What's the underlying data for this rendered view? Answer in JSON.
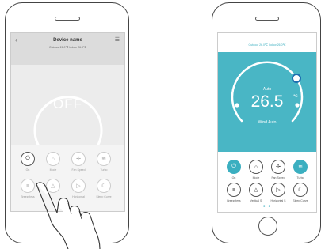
{
  "left_screen": {
    "back_icon": "chevron-left-icon",
    "title": "Device name",
    "subtitle": "Outdoor 26.0℃ Indoor 26.0℃",
    "power_state": "OFF",
    "buttons": [
      {
        "label": "On",
        "icon": "power-icon"
      },
      {
        "label": "Mode",
        "icon": "home-icon"
      },
      {
        "label": "Fan Speed",
        "icon": "fan-icon"
      },
      {
        "label": "Turbo",
        "icon": "turbo-icon"
      },
      {
        "label": "Breezeless",
        "icon": "breeze-icon"
      },
      {
        "label": "",
        "icon": "bell-icon"
      },
      {
        "label": "Horizontal",
        "icon": "play-icon"
      },
      {
        "label": "Sleep Curve",
        "icon": "sleep-icon"
      }
    ]
  },
  "right_screen": {
    "subtitle": "Outdoor 26.0℃ Indoor 26.0℃",
    "mode": "Auto",
    "temperature": "26.5",
    "unit": "℃",
    "wind": "Wind Auto",
    "page_dots": "● ●",
    "buttons": [
      {
        "label": "On",
        "icon": "power-icon"
      },
      {
        "label": "Mode",
        "icon": "home-icon"
      },
      {
        "label": "Fan Speed",
        "icon": "fan-icon"
      },
      {
        "label": "Turbo",
        "icon": "turbo-icon"
      },
      {
        "label": "Breezeless",
        "icon": "breeze-icon"
      },
      {
        "label": "Vertical S",
        "icon": "bell-icon"
      },
      {
        "label": "Horizontal S",
        "icon": "play-icon"
      },
      {
        "label": "Sleep Curve",
        "icon": "sleep-icon"
      }
    ]
  },
  "colors": {
    "accent": "#49b6c5",
    "off_panel": "#dcdcdc"
  }
}
